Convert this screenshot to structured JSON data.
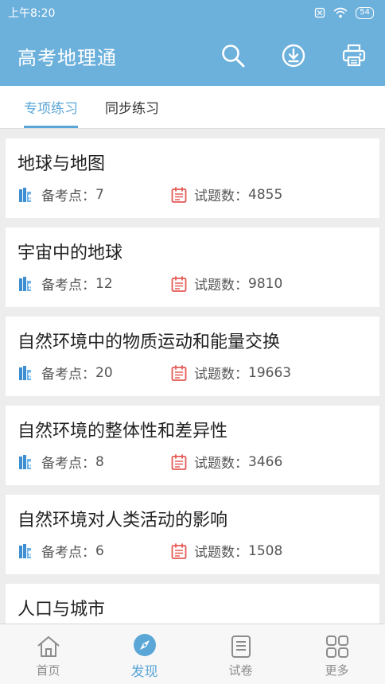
{
  "status": {
    "time": "上午8:20",
    "battery": "54"
  },
  "app": {
    "title": "高考地理通"
  },
  "actions": {
    "search": "search-icon",
    "download": "download-icon",
    "print": "printer-icon"
  },
  "tabs": [
    {
      "label": "专项练习",
      "active": true
    },
    {
      "label": "同步练习",
      "active": false
    }
  ],
  "meta_labels": {
    "points": "备考点：",
    "questions": "试题数："
  },
  "topics": [
    {
      "title": "地球与地图",
      "points": "7",
      "questions": "4855"
    },
    {
      "title": "宇宙中的地球",
      "points": "12",
      "questions": "9810"
    },
    {
      "title": "自然环境中的物质运动和能量交换",
      "points": "20",
      "questions": "19663"
    },
    {
      "title": "自然环境的整体性和差异性",
      "points": "8",
      "questions": "3466"
    },
    {
      "title": "自然环境对人类活动的影响",
      "points": "6",
      "questions": "1508"
    },
    {
      "title": "人口与城市"
    }
  ],
  "bottom_nav": [
    {
      "label": "首页",
      "icon": "home-icon",
      "active": false
    },
    {
      "label": "发现",
      "icon": "compass-icon",
      "active": true
    },
    {
      "label": "试卷",
      "icon": "paper-icon",
      "active": false
    },
    {
      "label": "更多",
      "icon": "grid-icon",
      "active": false
    }
  ],
  "colors": {
    "primary": "#6cb0dc",
    "accent": "#5aa6d6",
    "book_icon": "#3d8fd1",
    "calendar_icon": "#e55a55"
  }
}
